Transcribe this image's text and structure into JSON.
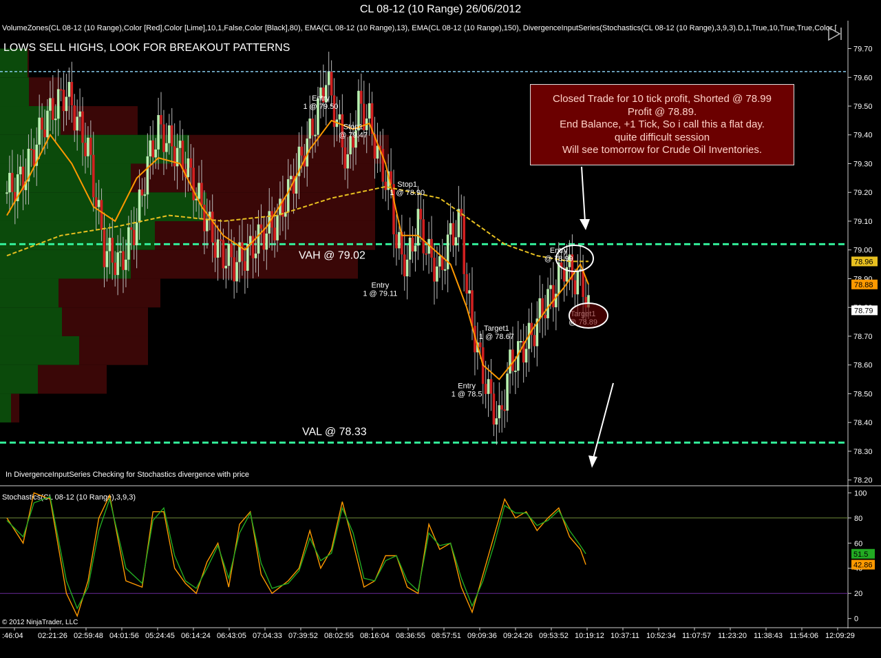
{
  "window_title": "CL 08-12 (10 Range)  26/06/2012",
  "indicator_line": "VolumeZones(CL 08-12 (10 Range),Color [Red],Color [Lime],10,1,False,Color [Black],80), EMA(CL 08-12 (10 Range),13), EMA(CL 08-12 (10 Range),150), DivergenceInputSeries(Stochastics(CL 08-12 (10 Range),3,9,3).D,1,True,10,True,True,Color [",
  "headline": "LOWS SELL HIGHS, LOOK FOR BREAKOUT PATTERNS",
  "divergence_note": "In DivergenceInputSeries Checking for Stochastics  divergence with price",
  "copyright": "© 2012 NinjaTrader, LLC",
  "stoch_label": "Stochastics(CL 08-12 (10 Range),3,9,3)",
  "annotation_lines": [
    "Closed Trade for 10 tick profit, Shorted @ 78.99",
    "Profit @ 78.89.",
    "End Balance, +1 Tick, So i call this a flat day.",
    "quite difficult session",
    "Will see tomorrow for Crude Oil Inventories."
  ],
  "colors": {
    "up_candle": "#b8f0b0",
    "down_candle": "#d02020",
    "ema13": "#ff9900",
    "ema150": "#e8c020",
    "value_area_line": "#33ee99",
    "high_line": "#88ccee",
    "zone_buy": "#0b4a0b",
    "zone_sell": "#3a0707",
    "stoch_k": "#ff9900",
    "stoch_d": "#22aa22"
  },
  "chart_data": [
    {
      "type": "candlestick",
      "title": "CL 08-12 (10 Range)  26/06/2012",
      "ylim": [
        78.18,
        79.73
      ],
      "y_ticks": [
        79.7,
        79.6,
        79.5,
        79.4,
        79.3,
        79.2,
        79.1,
        79.0,
        78.9,
        78.8,
        78.7,
        78.6,
        78.5,
        78.4,
        78.3,
        78.2
      ],
      "y_tick_labels": [
        "79.70",
        "79.60",
        "79.50",
        "79.40",
        "79.30",
        "79.20",
        "79.10",
        "79.00",
        "78.90",
        "78.80",
        "78.70",
        "78.60",
        "78.50",
        "78.40",
        "78.30",
        "78.20"
      ],
      "x_tick_labels": [
        ":46:04",
        "02:21:26",
        "02:59:48",
        "04:01:56",
        "05:24:45",
        "06:14:24",
        "06:43:05",
        "07:04:33",
        "07:39:52",
        "08:02:55",
        "08:16:04",
        "08:36:55",
        "08:57:51",
        "09:09:36",
        "09:24:26",
        "09:53:52",
        "10:19:12",
        "10:37:11",
        "10:52:34",
        "11:07:57",
        "11:23:20",
        "11:38:43",
        "11:54:06",
        "12:09:29"
      ],
      "price_badges": [
        {
          "value": 78.96,
          "label": "78.96",
          "color": "#e8c020"
        },
        {
          "value": 78.88,
          "label": "78.88",
          "color": "#ff9900"
        },
        {
          "value": 78.79,
          "label": "78.79",
          "color": "#ffffff"
        }
      ],
      "levels": [
        {
          "value": 79.62,
          "label": "",
          "color": "#88ccee"
        },
        {
          "value": 79.02,
          "label": "VAH @ 79.02",
          "color": "#33ee99"
        },
        {
          "value": 78.33,
          "label": "VAL @ 78.33",
          "color": "#33ee99"
        }
      ],
      "volume_zones": [
        {
          "low": 79.6,
          "high": 79.7,
          "buy": 40,
          "sell": 2
        },
        {
          "low": 79.5,
          "high": 79.6,
          "buy": 42,
          "sell": 45
        },
        {
          "low": 79.4,
          "high": 79.5,
          "buy": 88,
          "sell": 112
        },
        {
          "low": 79.3,
          "high": 79.4,
          "buy": 275,
          "sell": 290
        },
        {
          "low": 79.2,
          "high": 79.3,
          "buy": 190,
          "sell": 355
        },
        {
          "low": 79.1,
          "high": 79.2,
          "buy": 300,
          "sell": 245
        },
        {
          "low": 79.0,
          "high": 79.1,
          "buy": 225,
          "sell": 320
        },
        {
          "low": 78.9,
          "high": 79.0,
          "buy": 190,
          "sell": 330
        },
        {
          "low": 78.8,
          "high": 78.9,
          "buy": 85,
          "sell": 148
        },
        {
          "low": 78.7,
          "high": 78.8,
          "buy": 90,
          "sell": 125
        },
        {
          "low": 78.6,
          "high": 78.7,
          "buy": 115,
          "sell": 100
        },
        {
          "low": 78.5,
          "high": 78.6,
          "buy": 55,
          "sell": 100
        },
        {
          "low": 78.4,
          "high": 78.5,
          "buy": 16,
          "sell": 12
        }
      ],
      "close_path": [
        [
          0,
          79.2
        ],
        [
          6,
          79.25
        ],
        [
          14,
          79.45
        ],
        [
          22,
          79.55
        ],
        [
          30,
          79.35
        ],
        [
          36,
          79.0
        ],
        [
          42,
          78.95
        ],
        [
          48,
          79.1
        ],
        [
          52,
          79.3
        ],
        [
          56,
          79.42
        ],
        [
          62,
          79.35
        ],
        [
          66,
          79.3
        ],
        [
          70,
          79.2
        ],
        [
          74,
          79.1
        ],
        [
          78,
          79.0
        ],
        [
          84,
          78.95
        ],
        [
          90,
          79.0
        ],
        [
          94,
          79.05
        ],
        [
          100,
          79.1
        ],
        [
          106,
          79.25
        ],
        [
          110,
          79.35
        ],
        [
          114,
          79.45
        ],
        [
          118,
          79.6
        ],
        [
          122,
          79.45
        ],
        [
          126,
          79.3
        ],
        [
          130,
          79.5
        ],
        [
          134,
          79.45
        ],
        [
          138,
          79.3
        ],
        [
          142,
          79.2
        ],
        [
          144,
          79.02
        ],
        [
          148,
          78.95
        ],
        [
          152,
          79.1
        ],
        [
          156,
          78.98
        ],
        [
          160,
          78.92
        ],
        [
          164,
          79.05
        ],
        [
          168,
          79.1
        ],
        [
          170,
          78.85
        ],
        [
          174,
          78.65
        ],
        [
          178,
          78.5
        ],
        [
          182,
          78.4
        ],
        [
          186,
          78.6
        ],
        [
          190,
          78.65
        ],
        [
          194,
          78.7
        ],
        [
          198,
          78.8
        ],
        [
          202,
          78.85
        ],
        [
          206,
          78.95
        ],
        [
          210,
          78.9
        ],
        [
          213,
          78.88
        ],
        [
          215,
          78.79
        ]
      ],
      "ema13_path": [
        [
          0,
          79.12
        ],
        [
          8,
          79.25
        ],
        [
          16,
          79.4
        ],
        [
          24,
          79.3
        ],
        [
          32,
          79.15
        ],
        [
          40,
          79.1
        ],
        [
          48,
          79.25
        ],
        [
          56,
          79.32
        ],
        [
          64,
          79.3
        ],
        [
          72,
          79.15
        ],
        [
          80,
          79.05
        ],
        [
          88,
          79.0
        ],
        [
          96,
          79.08
        ],
        [
          104,
          79.2
        ],
        [
          112,
          79.35
        ],
        [
          120,
          79.45
        ],
        [
          128,
          79.42
        ],
        [
          134,
          79.44
        ],
        [
          140,
          79.3
        ],
        [
          146,
          79.05
        ],
        [
          152,
          79.05
        ],
        [
          158,
          79.0
        ],
        [
          164,
          78.95
        ],
        [
          170,
          78.8
        ],
        [
          176,
          78.6
        ],
        [
          182,
          78.55
        ],
        [
          188,
          78.62
        ],
        [
          194,
          78.72
        ],
        [
          200,
          78.8
        ],
        [
          206,
          78.87
        ],
        [
          212,
          78.95
        ],
        [
          215,
          78.88
        ]
      ],
      "ema150_path": [
        [
          0,
          78.98
        ],
        [
          20,
          79.05
        ],
        [
          40,
          79.08
        ],
        [
          60,
          79.12
        ],
        [
          80,
          79.1
        ],
        [
          100,
          79.12
        ],
        [
          120,
          79.18
        ],
        [
          140,
          79.22
        ],
        [
          160,
          79.18
        ],
        [
          172,
          79.1
        ],
        [
          184,
          79.02
        ],
        [
          196,
          78.98
        ],
        [
          208,
          78.96
        ],
        [
          215,
          78.96
        ]
      ],
      "bar_count": 216,
      "trade_markers": [
        {
          "bar": 116,
          "price": 79.5,
          "text": [
            "Entry",
            "1 @ 79.50"
          ]
        },
        {
          "bar": 128,
          "price": 79.4,
          "text": [
            "Stop1",
            "@ 79.47"
          ]
        },
        {
          "bar": 148,
          "price": 79.2,
          "text": [
            "Stop1",
            "1 @ 78.90"
          ]
        },
        {
          "bar": 138,
          "price": 78.85,
          "text": [
            "Entry",
            "1 @ 79.11"
          ]
        },
        {
          "bar": 181,
          "price": 78.7,
          "text": [
            "Target1",
            "1 @ 78.67"
          ]
        },
        {
          "bar": 170,
          "price": 78.5,
          "text": [
            "Entry",
            "1 @ 78.5"
          ]
        },
        {
          "bar": 204,
          "price": 78.97,
          "text": [
            "Entry",
            "@ 78.99"
          ]
        },
        {
          "bar": 213,
          "price": 78.75,
          "text": [
            "Target1",
            "@ 78.89"
          ]
        }
      ]
    },
    {
      "type": "line",
      "title": "Stochastics(CL 08-12 (10 Range),3,9,3)",
      "ylim": [
        -4,
        104
      ],
      "y_ticks": [
        100,
        80,
        60,
        40,
        20,
        0
      ],
      "y_tick_labels": [
        "100",
        "80",
        "60",
        "40",
        "20",
        "0"
      ],
      "guide_lines": [
        80,
        20
      ],
      "current_values": [
        {
          "value": 51.5,
          "label": "51.5",
          "color": "#22aa22"
        },
        {
          "value": 42.86,
          "label": "42.86",
          "color": "#ff9900"
        }
      ],
      "series": [
        {
          "color": "#ff9900",
          "points": [
            [
              0,
              80
            ],
            [
              6,
              60
            ],
            [
              10,
              100
            ],
            [
              16,
              95
            ],
            [
              22,
              20
            ],
            [
              26,
              2
            ],
            [
              30,
              30
            ],
            [
              34,
              80
            ],
            [
              38,
              98
            ],
            [
              44,
              30
            ],
            [
              50,
              25
            ],
            [
              54,
              85
            ],
            [
              58,
              85
            ],
            [
              62,
              40
            ],
            [
              66,
              28
            ],
            [
              70,
              20
            ],
            [
              74,
              45
            ],
            [
              78,
              60
            ],
            [
              82,
              25
            ],
            [
              86,
              75
            ],
            [
              90,
              85
            ],
            [
              94,
              35
            ],
            [
              98,
              20
            ],
            [
              104,
              30
            ],
            [
              108,
              40
            ],
            [
              112,
              70
            ],
            [
              116,
              40
            ],
            [
              120,
              55
            ],
            [
              124,
              93
            ],
            [
              128,
              60
            ],
            [
              132,
              25
            ],
            [
              136,
              30
            ],
            [
              140,
              50
            ],
            [
              144,
              50
            ],
            [
              148,
              25
            ],
            [
              152,
              20
            ],
            [
              156,
              75
            ],
            [
              160,
              55
            ],
            [
              164,
              60
            ],
            [
              168,
              25
            ],
            [
              172,
              5
            ],
            [
              176,
              35
            ],
            [
              180,
              65
            ],
            [
              184,
              95
            ],
            [
              188,
              80
            ],
            [
              192,
              85
            ],
            [
              196,
              70
            ],
            [
              200,
              80
            ],
            [
              204,
              88
            ],
            [
              208,
              65
            ],
            [
              212,
              55
            ],
            [
              214,
              42.86
            ]
          ]
        },
        {
          "color": "#22aa22",
          "points": [
            [
              0,
              78
            ],
            [
              6,
              65
            ],
            [
              10,
              92
            ],
            [
              16,
              97
            ],
            [
              22,
              30
            ],
            [
              26,
              8
            ],
            [
              30,
              25
            ],
            [
              34,
              70
            ],
            [
              38,
              95
            ],
            [
              44,
              40
            ],
            [
              50,
              28
            ],
            [
              54,
              78
            ],
            [
              58,
              88
            ],
            [
              62,
              50
            ],
            [
              66,
              30
            ],
            [
              70,
              24
            ],
            [
              74,
              40
            ],
            [
              78,
              58
            ],
            [
              82,
              32
            ],
            [
              86,
              68
            ],
            [
              90,
              84
            ],
            [
              94,
              44
            ],
            [
              98,
              24
            ],
            [
              104,
              28
            ],
            [
              108,
              38
            ],
            [
              112,
              64
            ],
            [
              116,
              46
            ],
            [
              120,
              52
            ],
            [
              124,
              88
            ],
            [
              128,
              68
            ],
            [
              132,
              32
            ],
            [
              136,
              30
            ],
            [
              140,
              46
            ],
            [
              144,
              50
            ],
            [
              148,
              30
            ],
            [
              152,
              22
            ],
            [
              156,
              68
            ],
            [
              160,
              58
            ],
            [
              164,
              60
            ],
            [
              168,
              32
            ],
            [
              172,
              10
            ],
            [
              176,
              30
            ],
            [
              180,
              58
            ],
            [
              184,
              90
            ],
            [
              188,
              84
            ],
            [
              192,
              84
            ],
            [
              196,
              74
            ],
            [
              200,
              78
            ],
            [
              204,
              86
            ],
            [
              208,
              70
            ],
            [
              212,
              58
            ],
            [
              214,
              51.5
            ]
          ]
        }
      ]
    }
  ]
}
